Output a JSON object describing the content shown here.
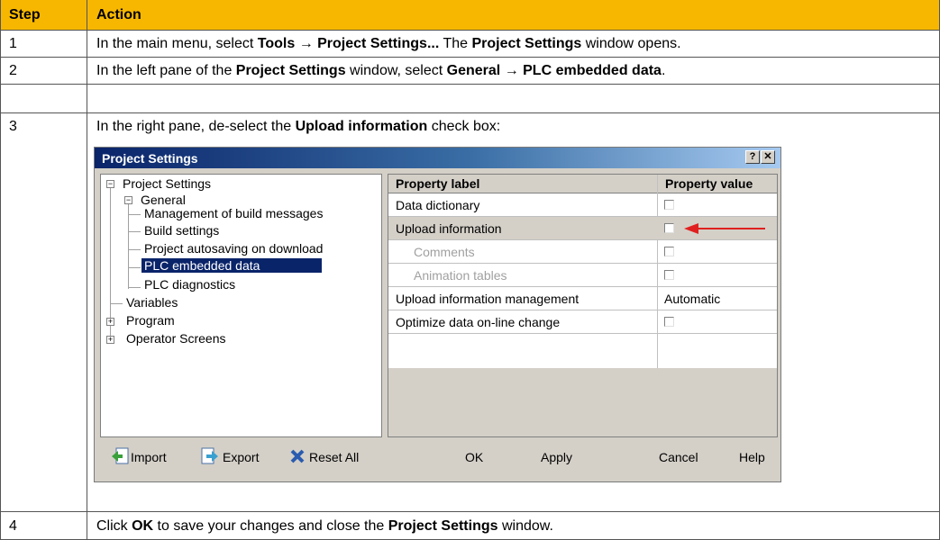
{
  "table": {
    "header": {
      "step": "Step",
      "action": "Action"
    },
    "rows": [
      {
        "num": "1",
        "parts": [
          "In the main menu, select ",
          "Tools → Project Settings...",
          " The ",
          "Project Settings",
          " window opens."
        ]
      },
      {
        "num": "2",
        "parts": [
          "In the left pane of the ",
          "Project Settings",
          " window, select ",
          "General → PLC embedded data",
          "."
        ]
      },
      {
        "num": "3",
        "parts": [
          "In the right pane, de-select the ",
          "Upload information",
          " check box:"
        ]
      },
      {
        "num": "4",
        "parts": [
          "Click ",
          "OK",
          " to save your changes and close the ",
          "Project Settings",
          " window."
        ]
      }
    ]
  },
  "dialog": {
    "title": "Project Settings",
    "help_btn": "?",
    "close_btn": "✕",
    "tree": {
      "root": "Project Settings",
      "general": "General",
      "children": [
        "Management of build messages",
        "Build settings",
        "Project autosaving on download",
        "PLC embedded data",
        "PLC diagnostics"
      ],
      "variables": "Variables",
      "program": "Program",
      "operator": "Operator Screens"
    },
    "grid": {
      "col_label": "Property label",
      "col_value": "Property value",
      "rows": [
        {
          "label": "Data dictionary",
          "value": ""
        },
        {
          "label": "Upload information",
          "value": ""
        },
        {
          "label": "Comments",
          "value": ""
        },
        {
          "label": "Animation tables",
          "value": ""
        },
        {
          "label": "Upload information management",
          "value": "Automatic"
        },
        {
          "label": "Optimize data on-line change",
          "value": ""
        }
      ]
    },
    "buttons": {
      "import": "Import",
      "export": "Export",
      "reset": "Reset All",
      "ok": "OK",
      "apply": "Apply",
      "cancel": "Cancel",
      "help": "Help"
    }
  },
  "colors": {
    "header_bg": "#f7b700",
    "selection": "#0a246a",
    "arrow": "#e02020"
  }
}
